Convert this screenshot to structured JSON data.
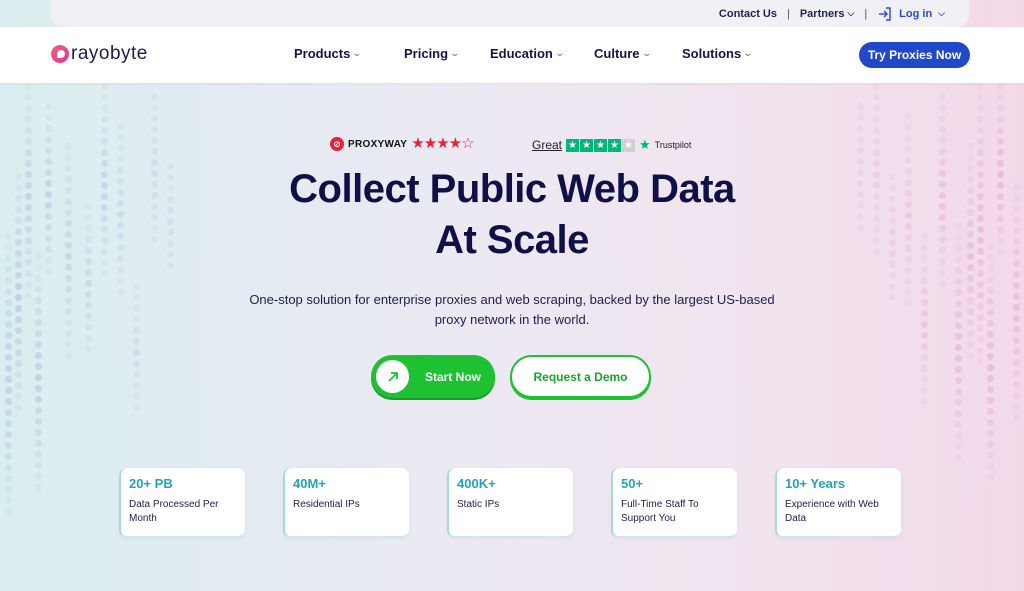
{
  "topbar": {
    "contact": "Contact Us",
    "separator": "|",
    "partners": "Partners",
    "login": "Log in"
  },
  "nav": {
    "logo_text": "rayobyte",
    "items": [
      {
        "label": "Products"
      },
      {
        "label": "Pricing"
      },
      {
        "label": "Education"
      },
      {
        "label": "Culture"
      },
      {
        "label": "Solutions"
      }
    ],
    "cta": "Try Proxies Now"
  },
  "ratings": {
    "proxyway_name": "PROXYWAY",
    "proxyway_stars_filled": 4,
    "proxyway_stars_total": 5,
    "trustpilot_label": "Great",
    "trustpilot_stars_filled": 4,
    "trustpilot_stars_total": 5,
    "trustpilot_name": "Trustpilot"
  },
  "hero": {
    "title_line1": "Collect Public Web Data",
    "title_line2": "At Scale",
    "subtitle_line1": "One-stop solution for enterprise proxies and web scraping, backed by the largest US-based",
    "subtitle_line2": "proxy network in the world.",
    "primary_button": "Start Now",
    "secondary_button": "Request a Demo"
  },
  "stats": [
    {
      "value": "20+ PB",
      "label": "Data Processed Per Month"
    },
    {
      "value": "40M+",
      "label": "Residential IPs"
    },
    {
      "value": "400K+",
      "label": "Static IPs"
    },
    {
      "value": "50+",
      "label": "Full-Time Staff To Support You"
    },
    {
      "value": "10+ Years",
      "label": "Experience with Web Data"
    }
  ],
  "colors": {
    "brand_blue": "#2148c9",
    "brand_green": "#1ec132",
    "stat_teal": "#25a3b6",
    "proxyway_red": "#e8223a",
    "trustpilot_green": "#00b67a"
  }
}
